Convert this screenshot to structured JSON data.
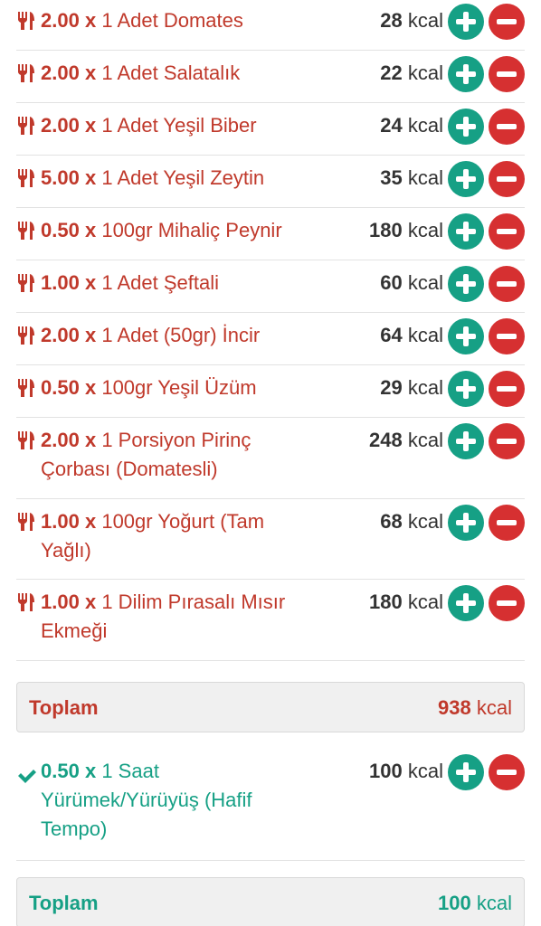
{
  "colors": {
    "food_red": "#c0392b",
    "exercise_green": "#16a085",
    "plus_button": "#16a085",
    "minus_button": "#d63031"
  },
  "food_items": [
    {
      "qty": "2.00",
      "x": "x",
      "desc": "1 Adet Domates",
      "kcal_num": "28",
      "kcal_unit": "kcal",
      "icon": "fork-knife-icon"
    },
    {
      "qty": "2.00",
      "x": "x",
      "desc": "1 Adet Salatalık",
      "kcal_num": "22",
      "kcal_unit": "kcal",
      "icon": "fork-knife-icon"
    },
    {
      "qty": "2.00",
      "x": "x",
      "desc": "1 Adet Yeşil Biber",
      "kcal_num": "24",
      "kcal_unit": "kcal",
      "icon": "fork-knife-icon"
    },
    {
      "qty": "5.00",
      "x": "x",
      "desc": "1 Adet Yeşil Zeytin",
      "kcal_num": "35",
      "kcal_unit": "kcal",
      "icon": "fork-knife-icon"
    },
    {
      "qty": "0.50",
      "x": "x",
      "desc": "100gr Mihaliç Peynir",
      "kcal_num": "180",
      "kcal_unit": "kcal",
      "icon": "fork-knife-icon"
    },
    {
      "qty": "1.00",
      "x": "x",
      "desc": "1 Adet Şeftali",
      "kcal_num": "60",
      "kcal_unit": "kcal",
      "icon": "fork-knife-icon"
    },
    {
      "qty": "2.00",
      "x": "x",
      "desc": "1 Adet (50gr) İncir",
      "kcal_num": "64",
      "kcal_unit": "kcal",
      "icon": "fork-knife-icon"
    },
    {
      "qty": "0.50",
      "x": "x",
      "desc": "100gr Yeşil Üzüm",
      "kcal_num": "29",
      "kcal_unit": "kcal",
      "icon": "fork-knife-icon"
    },
    {
      "qty": "2.00",
      "x": "x",
      "desc": "1 Porsiyon Pirinç Çorbası (Domatesli)",
      "kcal_num": "248",
      "kcal_unit": "kcal",
      "icon": "fork-knife-icon"
    },
    {
      "qty": "1.00",
      "x": "x",
      "desc": "100gr Yoğurt (Tam Yağlı)",
      "kcal_num": "68",
      "kcal_unit": "kcal",
      "icon": "fork-knife-icon"
    },
    {
      "qty": "1.00",
      "x": "x",
      "desc": "1 Dilim Pırasalı Mısır Ekmeği",
      "kcal_num": "180",
      "kcal_unit": "kcal",
      "icon": "fork-knife-icon"
    }
  ],
  "food_total": {
    "label": "Toplam",
    "value_num": "938",
    "value_unit": "kcal"
  },
  "exercise_items": [
    {
      "qty": "0.50",
      "x": "x",
      "desc": "1 Saat Yürümek/Yürüyüş (Hafif Tempo)",
      "kcal_num": "100",
      "kcal_unit": "kcal",
      "icon": "check-icon"
    }
  ],
  "exercise_total": {
    "label": "Toplam",
    "value_num": "100",
    "value_unit": "kcal"
  }
}
